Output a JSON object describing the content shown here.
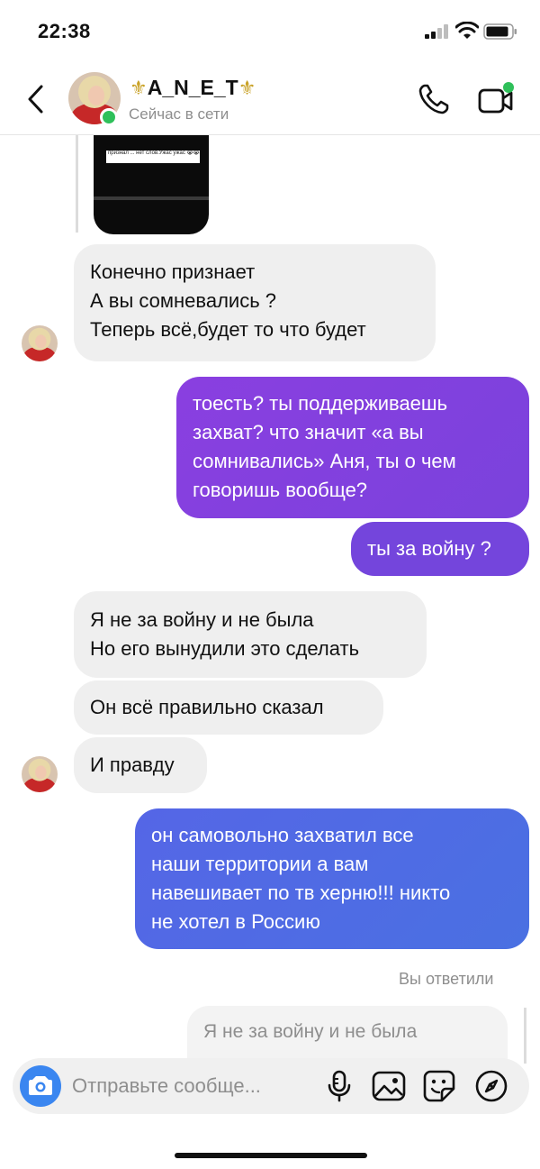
{
  "status_bar": {
    "time": "22:38"
  },
  "header": {
    "contact_name": "A_N_E_T",
    "name_ornament": "⚜",
    "status": "Сейчас в сети"
  },
  "colors": {
    "accent_blue": "#3a86f0",
    "online_green": "#2fc05a",
    "ornament_gold": "#c9a227"
  },
  "story_reply": {
    "caption": "признал ... нет слов.Ужас ужас 😭😭меня трусит"
  },
  "messages": [
    {
      "side": "incoming",
      "lines": [
        "Конечно признает",
        "А вы сомневались ?",
        "Теперь всё,будет то что будет"
      ]
    },
    {
      "side": "outgoing",
      "lines": [
        "тоесть? ты поддерживаешь",
        "захват? что значит «а вы",
        "сомнивались» Аня, ты о чем",
        "говоришь вообще?"
      ]
    },
    {
      "side": "outgoing",
      "lines": [
        "ты за войну ?"
      ]
    },
    {
      "side": "incoming",
      "lines": [
        "Я не за войну и не была",
        "Но его вынудили это сделать"
      ]
    },
    {
      "side": "incoming",
      "lines": [
        "Он всё правильно сказал"
      ]
    },
    {
      "side": "incoming",
      "lines": [
        "И правду"
      ]
    },
    {
      "side": "outgoing",
      "lines": [
        "он самовольно захватил все",
        "наши территории а вам",
        "навешивает по тв херню!!! никто",
        "не хотел в Россию"
      ]
    }
  ],
  "reply": {
    "label": "Вы ответили",
    "preview": "Я не за войну и не была"
  },
  "composer": {
    "placeholder": "Отправьте сообще..."
  },
  "icons": {
    "back": "chevron-left-icon",
    "call": "phone-icon",
    "video": "video-call-icon",
    "camera": "camera-icon",
    "mic": "microphone-icon",
    "gallery": "image-icon",
    "sticker": "sticker-icon",
    "explore": "compass-icon"
  }
}
